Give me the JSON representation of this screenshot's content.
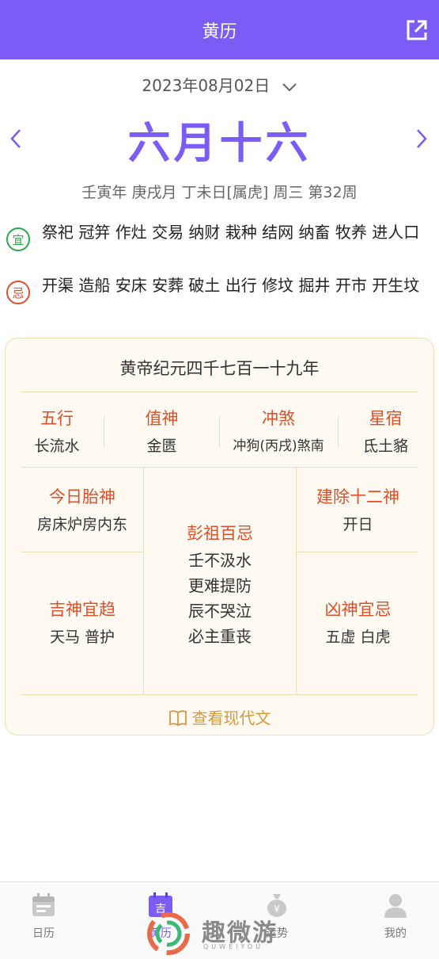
{
  "header": {
    "title": "黄历"
  },
  "date": {
    "display": "2023年08月02日"
  },
  "lunar": {
    "day": "六月十六"
  },
  "ganzhi": {
    "text": "壬寅年 庚戌月 丁未日[属虎] 周三 第32周"
  },
  "yi": {
    "badge": "宜",
    "text": "祭祀 冠笄 作灶 交易 纳财 栽种 结网 纳畜 牧养 进人口"
  },
  "ji": {
    "badge": "忌",
    "text": "开渠 造船 安床 安葬 破土 出行 修坟 掘井 开市 开生坟"
  },
  "card": {
    "title": "黄帝纪元四千七百一十九年",
    "row1": [
      {
        "label": "五行",
        "value": "长流水"
      },
      {
        "label": "值神",
        "value": "金匮"
      },
      {
        "label": "冲煞",
        "value": "冲狗(丙戌)煞南"
      },
      {
        "label": "星宿",
        "value": "氐土貉"
      }
    ],
    "taishen": {
      "label": "今日胎神",
      "value": "房床炉房内东"
    },
    "jishen": {
      "label": "吉神宜趋",
      "value": "天马 普护"
    },
    "pengzu": {
      "label": "彭祖百忌",
      "lines": [
        "壬不汲水",
        "更难提防",
        "辰不哭泣",
        "必主重丧"
      ]
    },
    "jianchu": {
      "label": "建除十二神",
      "value": "开日"
    },
    "xiongshen": {
      "label": "凶神宜忌",
      "value": "五虚 白虎"
    },
    "modern_link": "查看现代文"
  },
  "tabbar": {
    "tabs": [
      {
        "label": "日历",
        "icon": "calendar-icon"
      },
      {
        "label": "黄历",
        "icon": "almanac-icon",
        "icon_text": "吉"
      },
      {
        "label": "运势",
        "icon": "money-bag-icon"
      },
      {
        "label": "我的",
        "icon": "user-icon"
      }
    ]
  },
  "watermark": {
    "text": "趣微游",
    "sub": "QUWEIYOU"
  },
  "colors": {
    "accent": "#7b5cf5",
    "red_label": "#d9502c",
    "green_badge": "#2aa84a",
    "gold_link": "#d19a40",
    "card_bg": "#fffaf1",
    "card_border": "#f1ddb6"
  }
}
